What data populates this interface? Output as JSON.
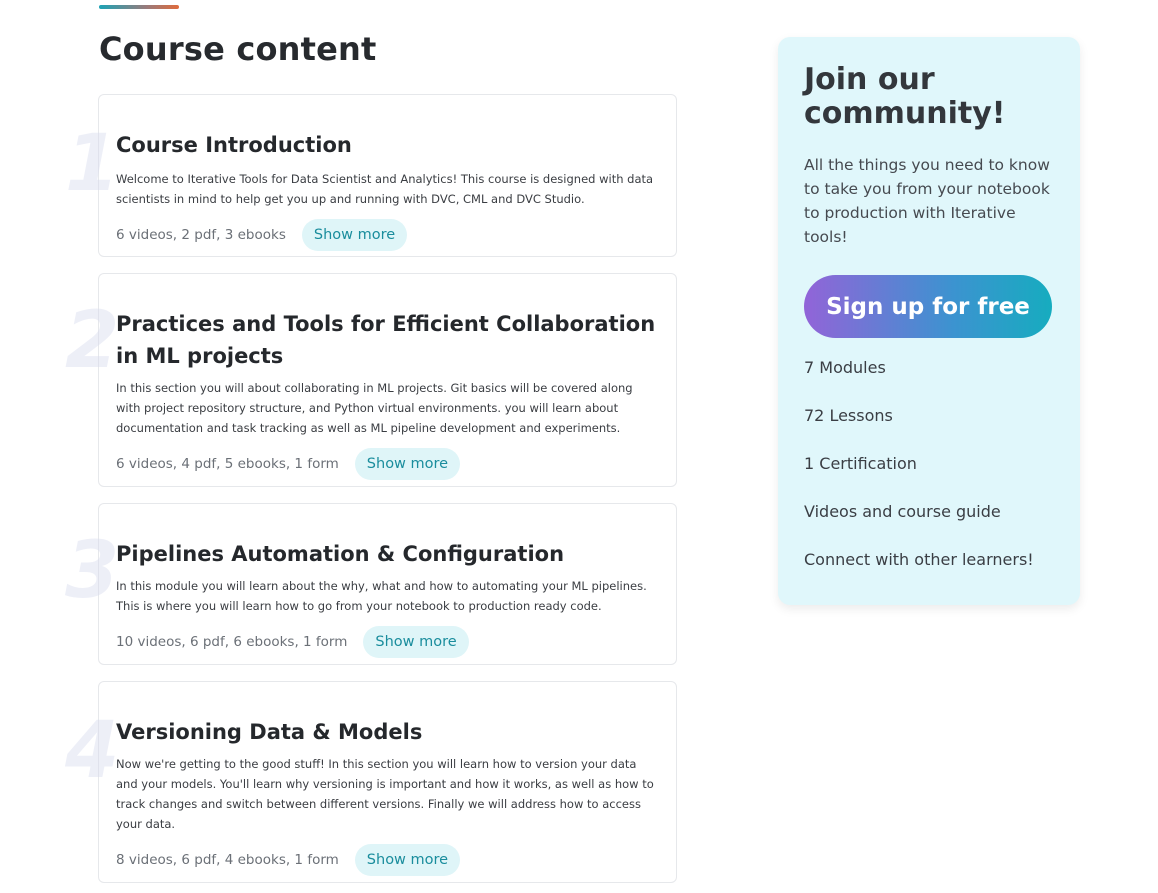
{
  "content": {
    "title": "Course content"
  },
  "modules": [
    {
      "number": "1",
      "title": "Course Introduction",
      "description": "Welcome to Iterative Tools for Data Scientist and Analytics! This course is designed with data scientists in mind to help get you up and running with DVC, CML and DVC Studio.",
      "meta": "6 videos, 2 pdf, 3 ebooks",
      "button": "Show more"
    },
    {
      "number": "2",
      "title": "Practices and Tools for Efficient Collaboration in ML projects",
      "description": "In this section you will about collaborating in ML projects. Git basics will be covered along with project repository structure, and Python virtual environments. you will learn about documentation and task tracking as well as ML pipeline development and experiments.",
      "meta": "6 videos, 4 pdf, 5 ebooks, 1 form",
      "button": "Show more"
    },
    {
      "number": "3",
      "title": "Pipelines Automation & Configuration",
      "description": "In this module you will learn about the why, what and how to automating your ML pipelines. This is where you will learn how to go from your notebook to production ready code.",
      "meta": "10 videos, 6 pdf, 6 ebooks, 1 form",
      "button": "Show more"
    },
    {
      "number": "4",
      "title": "Versioning Data & Models",
      "description": "Now we're getting to the good stuff! In this section you will learn how to version your data and your models. You'll learn why versioning is important and how it works, as well as how to track changes and switch between different versions. Finally we will address how to access your data.",
      "meta": "8 videos, 6 pdf, 4 ebooks, 1 form",
      "button": "Show more"
    }
  ],
  "sidebar": {
    "title": "Join our community!",
    "text": "All the things you need to know to take you from your notebook to production with Iterative tools!",
    "button": "Sign up for free",
    "features": [
      "7 Modules",
      "72 Lessons",
      "1 Certification",
      "Videos and course guide",
      "Connect with other learners!"
    ]
  },
  "colors": {
    "accent": "#1a8d9d",
    "sidebar_bg": "#e0f7fb",
    "button_gradient_start": "#9264d8",
    "button_gradient_end": "#16acbf"
  }
}
